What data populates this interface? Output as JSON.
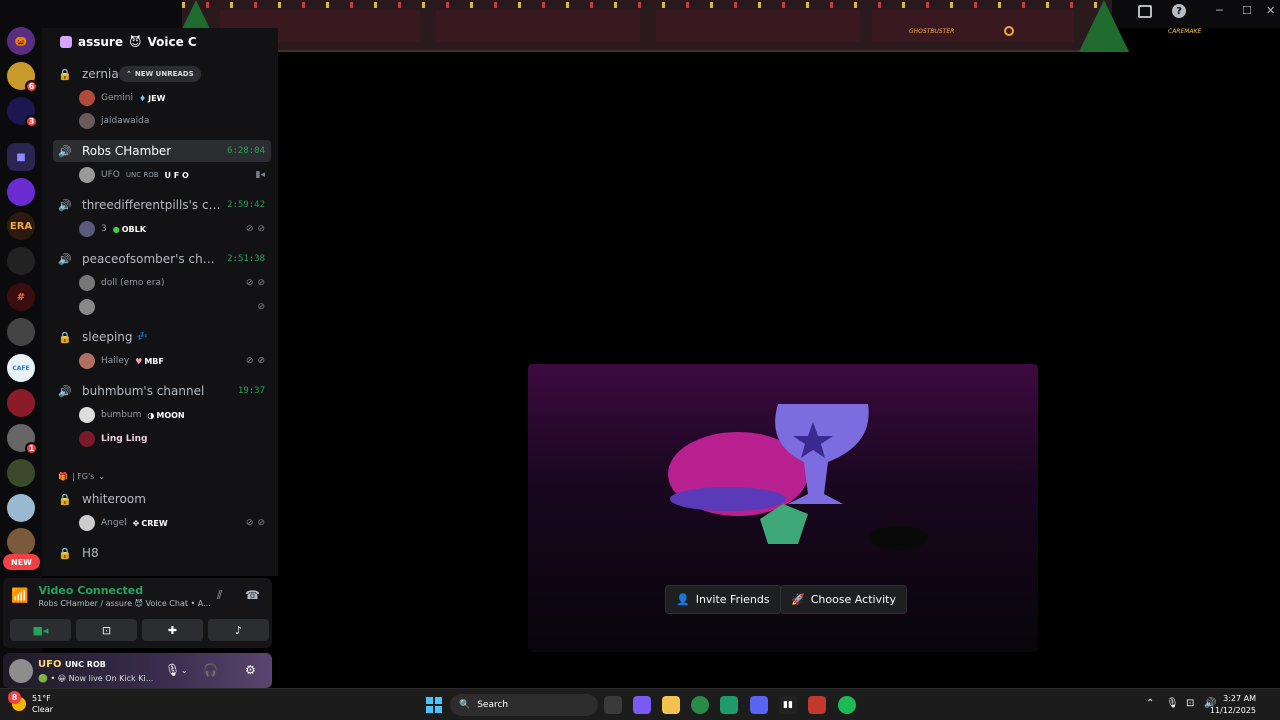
{
  "guild": {
    "name": "assure",
    "channel_suffix": "Voice C"
  },
  "new_unreads": "NEW UNREADS",
  "rail_badges": [
    "6",
    "3",
    "1"
  ],
  "rail_new": "NEW",
  "channels": [
    {
      "name": "zerniaa'",
      "type": "locked"
    },
    {
      "name": "Robs CHamber",
      "type": "voice",
      "time": "6:28:04",
      "active": true
    },
    {
      "name": "threedifferentpills's cha...",
      "type": "voice",
      "time": "2:59:42"
    },
    {
      "name": "peaceofsomber's channel",
      "type": "voice",
      "time": "2:51:38"
    },
    {
      "name": "sleeping",
      "type": "locked",
      "emoji": "💤"
    },
    {
      "name": "buhmbum's channel",
      "type": "voice",
      "time": "19:37"
    },
    {
      "name": "whiteroom",
      "type": "locked"
    },
    {
      "name": "H8",
      "type": "locked"
    }
  ],
  "members": {
    "gemini": {
      "name": "Gemini",
      "tag": "JEW"
    },
    "jaidawaida": {
      "name": "jaidawaida"
    },
    "ufo": {
      "name": "UFO",
      "sub": "UNC ROB",
      "tag": "U F O"
    },
    "three": {
      "name": "3",
      "tag": "OBLK"
    },
    "doll": {
      "name": "doll (emo era)"
    },
    "hailey": {
      "name": "Hailey",
      "tag": "MBF"
    },
    "bumbum": {
      "name": "bumbum",
      "tag": "MOON"
    },
    "lingling": {
      "name": "Ling Ling"
    },
    "angel": {
      "name": "Angel",
      "tag": "CREW"
    }
  },
  "category": {
    "label": "| FG's"
  },
  "voice": {
    "title": "Video Connected",
    "subtitle": "Robs CHamber / assure",
    "subtitle_tail": "Voice Chat • A..."
  },
  "user": {
    "name": "UFO",
    "sub": "UNC ROB",
    "status": "Now live On Kick Ki..."
  },
  "topbar": {
    "deco_name_1": "GHOSTBUSTER",
    "deco_name_2": "CAREMAKE"
  },
  "activity": {
    "invite_label": "Invite Friends",
    "choose_label": "Choose Activity"
  },
  "taskbar": {
    "temp": "51°F",
    "weather": "Clear",
    "weather_badge": "8",
    "search_placeholder": "Search",
    "time": "3:27 AM",
    "date": "11/12/2025"
  },
  "colors": {
    "accent_green": "#23a55a",
    "danger": "#f23f43",
    "card_top": "#3c0a40"
  }
}
